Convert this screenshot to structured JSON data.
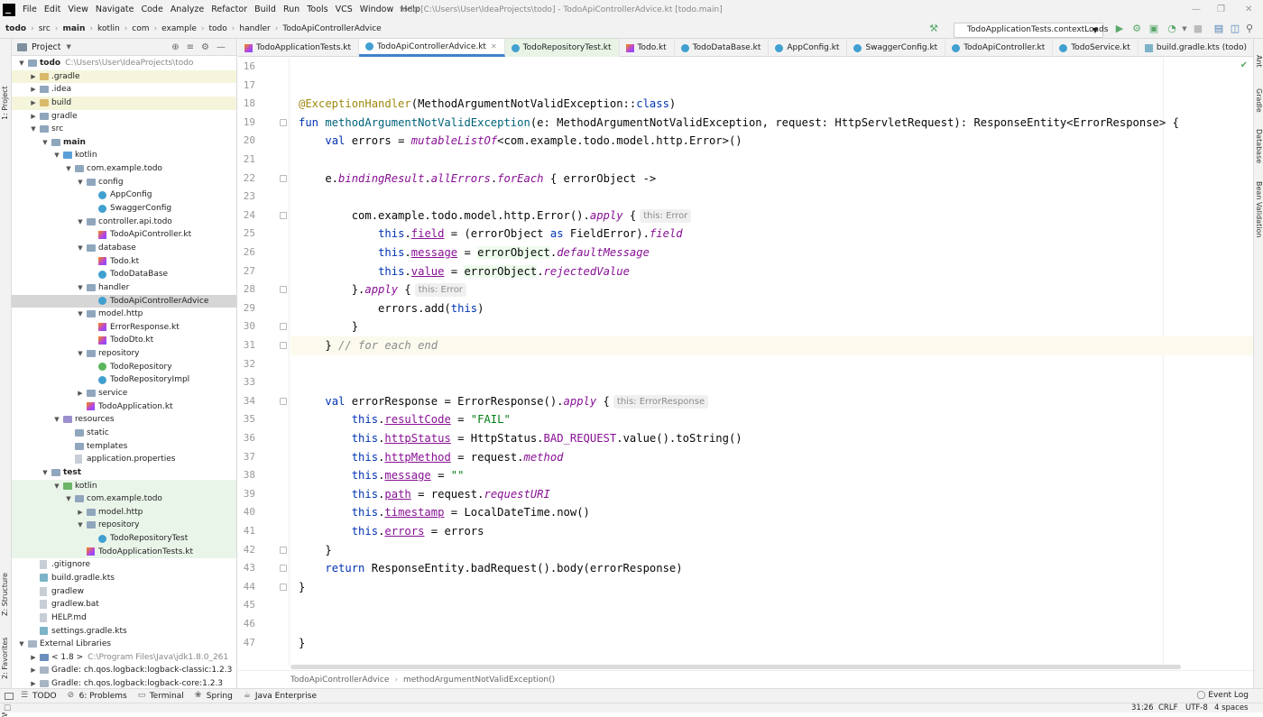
{
  "menubar": {
    "items": [
      "File",
      "Edit",
      "View",
      "Navigate",
      "Code",
      "Analyze",
      "Refactor",
      "Build",
      "Run",
      "Tools",
      "VCS",
      "Window",
      "Help"
    ],
    "window_title": "todo [C:\\Users\\User\\IdeaProjects\\todo] - TodoApiControllerAdvice.kt [todo.main]"
  },
  "navbar": {
    "crumbs": [
      "todo",
      "src",
      "main",
      "kotlin",
      "com",
      "example",
      "todo",
      "handler",
      "TodoApiControllerAdvice"
    ],
    "run_config": "TodoApplicationTests.contextLoads"
  },
  "left_strip": {
    "project": "1: Project",
    "structure": "Z: Structure",
    "favorites": "2: Favorites",
    "web": "Web"
  },
  "right_strip": {
    "ant": "Ant",
    "gradle": "Gradle",
    "database": "Database",
    "bean": "Bean Validation"
  },
  "project_panel": {
    "title": "Project",
    "tree": [
      {
        "label": "todo",
        "path": "C:\\Users\\User\\IdeaProjects\\todo",
        "depth": 0,
        "arrow": "down",
        "icon": "folder",
        "style": "",
        "bold": true
      },
      {
        "label": ".gradle",
        "depth": 1,
        "arrow": "right",
        "icon": "folder-y",
        "style": "yel"
      },
      {
        "label": ".idea",
        "depth": 1,
        "arrow": "right",
        "icon": "folder",
        "style": ""
      },
      {
        "label": "build",
        "depth": 1,
        "arrow": "right",
        "icon": "folder-y",
        "style": "yel"
      },
      {
        "label": "gradle",
        "depth": 1,
        "arrow": "right",
        "icon": "folder",
        "style": ""
      },
      {
        "label": "src",
        "depth": 1,
        "arrow": "down",
        "icon": "folder",
        "style": ""
      },
      {
        "label": "main",
        "depth": 2,
        "arrow": "down",
        "icon": "folder",
        "style": "",
        "bold": true
      },
      {
        "label": "kotlin",
        "depth": 3,
        "arrow": "down",
        "icon": "folder-src",
        "style": ""
      },
      {
        "label": "com.example.todo",
        "depth": 4,
        "arrow": "down",
        "icon": "folder",
        "style": ""
      },
      {
        "label": "config",
        "depth": 5,
        "arrow": "down",
        "icon": "folder",
        "style": ""
      },
      {
        "label": "AppConfig",
        "depth": 6,
        "arrow": "",
        "icon": "kc",
        "style": ""
      },
      {
        "label": "SwaggerConfig",
        "depth": 6,
        "arrow": "",
        "icon": "kc",
        "style": ""
      },
      {
        "label": "controller.api.todo",
        "depth": 5,
        "arrow": "down",
        "icon": "folder",
        "style": ""
      },
      {
        "label": "TodoApiController.kt",
        "depth": 6,
        "arrow": "",
        "icon": "kt",
        "style": ""
      },
      {
        "label": "database",
        "depth": 5,
        "arrow": "down",
        "icon": "folder",
        "style": ""
      },
      {
        "label": "Todo.kt",
        "depth": 6,
        "arrow": "",
        "icon": "kt",
        "style": ""
      },
      {
        "label": "TodoDataBase",
        "depth": 6,
        "arrow": "",
        "icon": "kc",
        "style": ""
      },
      {
        "label": "handler",
        "depth": 5,
        "arrow": "down",
        "icon": "folder",
        "style": ""
      },
      {
        "label": "TodoApiControllerAdvice",
        "depth": 6,
        "arrow": "",
        "icon": "kc",
        "style": "sel"
      },
      {
        "label": "model.http",
        "depth": 5,
        "arrow": "down",
        "icon": "folder",
        "style": ""
      },
      {
        "label": "ErrorResponse.kt",
        "depth": 6,
        "arrow": "",
        "icon": "kt",
        "style": ""
      },
      {
        "label": "TodoDto.kt",
        "depth": 6,
        "arrow": "",
        "icon": "kt",
        "style": ""
      },
      {
        "label": "repository",
        "depth": 5,
        "arrow": "down",
        "icon": "folder",
        "style": ""
      },
      {
        "label": "TodoRepository",
        "depth": 6,
        "arrow": "",
        "icon": "ki",
        "style": ""
      },
      {
        "label": "TodoRepositoryImpl",
        "depth": 6,
        "arrow": "",
        "icon": "kc",
        "style": ""
      },
      {
        "label": "service",
        "depth": 5,
        "arrow": "right",
        "icon": "folder",
        "style": ""
      },
      {
        "label": "TodoApplication.kt",
        "depth": 5,
        "arrow": "",
        "icon": "kt",
        "style": ""
      },
      {
        "label": "resources",
        "depth": 3,
        "arrow": "down",
        "icon": "folder-res",
        "style": ""
      },
      {
        "label": "static",
        "depth": 4,
        "arrow": "",
        "icon": "folder",
        "style": ""
      },
      {
        "label": "templates",
        "depth": 4,
        "arrow": "",
        "icon": "folder",
        "style": ""
      },
      {
        "label": "application.properties",
        "depth": 4,
        "arrow": "",
        "icon": "file",
        "style": ""
      },
      {
        "label": "test",
        "depth": 2,
        "arrow": "down",
        "icon": "folder",
        "style": "",
        "bold": true
      },
      {
        "label": "kotlin",
        "depth": 3,
        "arrow": "down",
        "icon": "folder-test",
        "style": "grn"
      },
      {
        "label": "com.example.todo",
        "depth": 4,
        "arrow": "down",
        "icon": "folder",
        "style": "grn"
      },
      {
        "label": "model.http",
        "depth": 5,
        "arrow": "right",
        "icon": "folder",
        "style": "grn"
      },
      {
        "label": "repository",
        "depth": 5,
        "arrow": "down",
        "icon": "folder",
        "style": "grn"
      },
      {
        "label": "TodoRepositoryTest",
        "depth": 6,
        "arrow": "",
        "icon": "kc",
        "style": "grn"
      },
      {
        "label": "TodoApplicationTests.kt",
        "depth": 5,
        "arrow": "",
        "icon": "kt",
        "style": "grn"
      },
      {
        "label": ".gitignore",
        "depth": 1,
        "arrow": "",
        "icon": "file",
        "style": ""
      },
      {
        "label": "build.gradle.kts",
        "depth": 1,
        "arrow": "",
        "icon": "gradle",
        "style": ""
      },
      {
        "label": "gradlew",
        "depth": 1,
        "arrow": "",
        "icon": "file",
        "style": ""
      },
      {
        "label": "gradlew.bat",
        "depth": 1,
        "arrow": "",
        "icon": "file",
        "style": ""
      },
      {
        "label": "HELP.md",
        "depth": 1,
        "arrow": "",
        "icon": "file",
        "style": ""
      },
      {
        "label": "settings.gradle.kts",
        "depth": 1,
        "arrow": "",
        "icon": "gradle",
        "style": ""
      },
      {
        "label": "External Libraries",
        "depth": 0,
        "arrow": "down",
        "icon": "lib",
        "style": ""
      },
      {
        "label": "< 1.8 >",
        "path": "C:\\Program Files\\Java\\jdk1.8.0_261",
        "depth": 1,
        "arrow": "right",
        "icon": "jdk",
        "style": ""
      },
      {
        "label": "Gradle: ch.qos.logback:logback-classic:1.2.3",
        "depth": 1,
        "arrow": "right",
        "icon": "lib",
        "style": ""
      },
      {
        "label": "Gradle: ch.qos.logback:logback-core:1.2.3",
        "depth": 1,
        "arrow": "right",
        "icon": "lib",
        "style": ""
      }
    ]
  },
  "editor": {
    "tabs": [
      {
        "label": "TodoApplicationTests.kt",
        "icon": "kt",
        "active": false,
        "test": false
      },
      {
        "label": "TodoApiControllerAdvice.kt",
        "icon": "kc",
        "active": true,
        "test": false
      },
      {
        "label": "TodoRepositoryTest.kt",
        "icon": "kc",
        "active": false,
        "test": true
      },
      {
        "label": "Todo.kt",
        "icon": "kt",
        "active": false,
        "test": false
      },
      {
        "label": "TodoDataBase.kt",
        "icon": "kc",
        "active": false,
        "test": false
      },
      {
        "label": "AppConfig.kt",
        "icon": "kc",
        "active": false,
        "test": false
      },
      {
        "label": "SwaggerConfig.kt",
        "icon": "kc",
        "active": false,
        "test": false
      },
      {
        "label": "TodoApiController.kt",
        "icon": "kc",
        "active": false,
        "test": false
      },
      {
        "label": "TodoService.kt",
        "icon": "kc",
        "active": false,
        "test": false
      },
      {
        "label": "build.gradle.kts (todo)",
        "icon": "gradle",
        "active": false,
        "test": false
      }
    ],
    "first_line": 16,
    "current_line": 31,
    "lines": [
      [],
      [],
      [
        [
          "an",
          "@ExceptionHandler"
        ],
        [
          "",
          "("
        ],
        [
          "",
          "MethodArgumentNotValidException::"
        ],
        [
          "kw",
          "class"
        ],
        [
          "",
          ")"
        ]
      ],
      [
        [
          "kw",
          "fun "
        ],
        [
          "fn",
          "methodArgumentNotValidException"
        ],
        [
          "",
          "(e: MethodArgumentNotValidException, request: HttpServletRequest): ResponseEntity<ErrorResponse> {"
        ]
      ],
      [
        [
          "",
          "    "
        ],
        [
          "kw",
          "val "
        ],
        [
          "",
          "errors = "
        ],
        [
          "ex",
          "mutableListOf"
        ],
        [
          "",
          "<com.example.todo.model.http.Error>()"
        ]
      ],
      [],
      [
        [
          "",
          "    e."
        ],
        [
          "ex",
          "bindingResult"
        ],
        [
          "",
          "."
        ],
        [
          "ex",
          "allErrors"
        ],
        [
          "",
          "."
        ],
        [
          "ex",
          "forEach"
        ],
        [
          "",
          " { errorObject ->"
        ]
      ],
      [],
      [
        [
          "",
          "        com.example.todo.model.http.Error()."
        ],
        [
          "ex",
          "apply"
        ],
        [
          "",
          " {"
        ],
        [
          "hint",
          "this: Error"
        ]
      ],
      [
        [
          "",
          "            "
        ],
        [
          "kw",
          "this"
        ],
        [
          "",
          "."
        ],
        [
          "pr ul",
          "field"
        ],
        [
          "",
          " = (errorObject "
        ],
        [
          "kw",
          "as"
        ],
        [
          "",
          " FieldError)."
        ],
        [
          "ex",
          "field"
        ]
      ],
      [
        [
          "",
          "            "
        ],
        [
          "kw",
          "this"
        ],
        [
          "",
          "."
        ],
        [
          "pr ul",
          "message"
        ],
        [
          "",
          " = "
        ],
        [
          "hl",
          "errorObject"
        ],
        [
          "",
          "."
        ],
        [
          "ex",
          "defaultMessage"
        ]
      ],
      [
        [
          "",
          "            "
        ],
        [
          "kw",
          "this"
        ],
        [
          "",
          "."
        ],
        [
          "pr ul",
          "value"
        ],
        [
          "",
          " = "
        ],
        [
          "hl",
          "errorObject"
        ],
        [
          "",
          "."
        ],
        [
          "ex",
          "rejectedValue"
        ]
      ],
      [
        [
          "",
          "        }."
        ],
        [
          "ex",
          "apply"
        ],
        [
          "",
          " {"
        ],
        [
          "hint",
          "this: Error"
        ]
      ],
      [
        [
          "",
          "            errors.add("
        ],
        [
          "kw",
          "this"
        ],
        [
          "",
          ")"
        ]
      ],
      [
        [
          "",
          "        }"
        ]
      ],
      [
        [
          "",
          "    } "
        ],
        [
          "cm",
          "// for each end"
        ]
      ],
      [],
      [],
      [
        [
          "",
          "    "
        ],
        [
          "kw",
          "val "
        ],
        [
          "",
          "errorResponse = ErrorResponse()."
        ],
        [
          "ex",
          "apply"
        ],
        [
          "",
          " {"
        ],
        [
          "hint",
          "this: ErrorResponse"
        ]
      ],
      [
        [
          "",
          "        "
        ],
        [
          "kw",
          "this"
        ],
        [
          "",
          "."
        ],
        [
          "pr ul",
          "resultCode"
        ],
        [
          "",
          " = "
        ],
        [
          "st",
          "\"FAIL\""
        ]
      ],
      [
        [
          "",
          "        "
        ],
        [
          "kw",
          "this"
        ],
        [
          "",
          "."
        ],
        [
          "pr ul",
          "httpStatus"
        ],
        [
          "",
          " = HttpStatus."
        ],
        [
          "pr",
          "BAD_REQUEST"
        ],
        [
          "",
          ".value().toString()"
        ]
      ],
      [
        [
          "",
          "        "
        ],
        [
          "kw",
          "this"
        ],
        [
          "",
          "."
        ],
        [
          "pr ul",
          "httpMethod"
        ],
        [
          "",
          " = request."
        ],
        [
          "ex",
          "method"
        ]
      ],
      [
        [
          "",
          "        "
        ],
        [
          "kw",
          "this"
        ],
        [
          "",
          "."
        ],
        [
          "pr ul",
          "message"
        ],
        [
          "",
          " = "
        ],
        [
          "st",
          "\"\""
        ]
      ],
      [
        [
          "",
          "        "
        ],
        [
          "kw",
          "this"
        ],
        [
          "",
          "."
        ],
        [
          "pr ul",
          "path"
        ],
        [
          "",
          " = request."
        ],
        [
          "ex",
          "requestURI"
        ]
      ],
      [
        [
          "",
          "        "
        ],
        [
          "kw",
          "this"
        ],
        [
          "",
          "."
        ],
        [
          "pr ul",
          "timestamp"
        ],
        [
          "",
          " = LocalDateTime.now()"
        ]
      ],
      [
        [
          "",
          "        "
        ],
        [
          "kw",
          "this"
        ],
        [
          "",
          "."
        ],
        [
          "pr ul",
          "errors"
        ],
        [
          "",
          " = errors"
        ]
      ],
      [
        [
          "",
          "    }"
        ]
      ],
      [
        [
          "",
          "    "
        ],
        [
          "kw",
          "return "
        ],
        [
          "",
          "ResponseEntity.badRequest().body(errorResponse)"
        ]
      ],
      [
        [
          "",
          "}"
        ]
      ],
      [],
      [],
      [
        [
          "",
          "}"
        ]
      ]
    ],
    "breadcrumb": [
      "TodoApiControllerAdvice",
      "methodArgumentNotValidException()"
    ]
  },
  "bottom_tools": [
    "TODO",
    "6: Problems",
    "Terminal",
    "Spring",
    "Java Enterprise"
  ],
  "event_log": "Event Log",
  "status": {
    "position": "31:26",
    "line_sep": "CRLF",
    "encoding": "UTF-8",
    "indent": "4 spaces"
  },
  "colors": {
    "accent": "#4083c9",
    "selection": "#d6d6d6",
    "keyword": "#0033b3",
    "annotation": "#9e880d"
  }
}
